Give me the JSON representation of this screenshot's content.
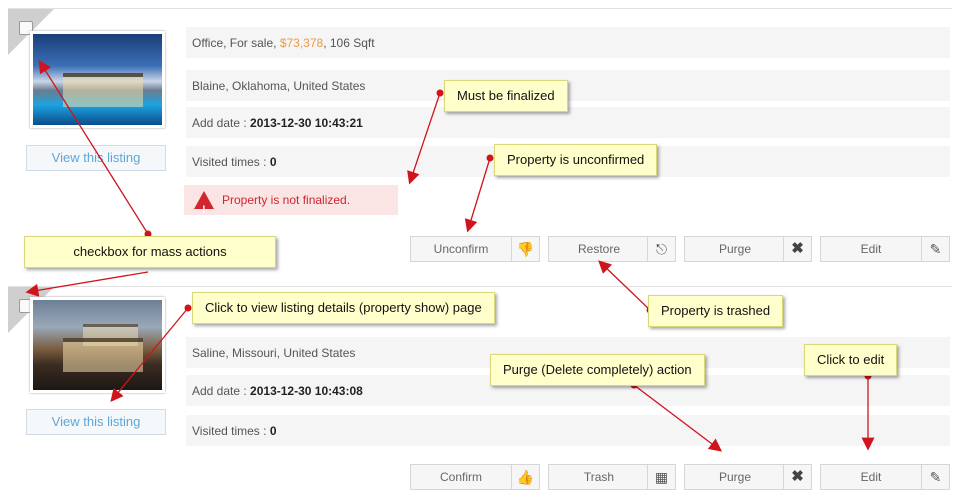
{
  "listings": [
    {
      "view_label": "View this listing",
      "summary": {
        "prefix": "Office, For sale, ",
        "price": "$73,378",
        "suffix": ", 106 Sqft"
      },
      "location": "Blaine, Oklahoma, United States",
      "add_date_label": "Add date : ",
      "add_date": "2013-12-30 10:43:21",
      "visited_label": "Visited times : ",
      "visited": "0",
      "alert": "Property is not finalized.",
      "actions": [
        "Unconfirm",
        "Restore",
        "Purge",
        "Edit"
      ]
    },
    {
      "view_label": "View this listing",
      "location": "Saline, Missouri, United States",
      "add_date_label": "Add date : ",
      "add_date": "2013-12-30 10:43:08",
      "visited_label": "Visited times : ",
      "visited": "0",
      "actions": [
        "Confirm",
        "Trash",
        "Purge",
        "Edit"
      ]
    }
  ],
  "callouts": {
    "must_finalize": "Must be finalized",
    "unconfirmed": "Property is unconfirmed",
    "mass_actions": "checkbox for mass actions",
    "view_details": "Click to view listing details (property show) page",
    "trashed": "Property is trashed",
    "purge": "Purge (Delete completely) action",
    "edit": "Click to edit"
  },
  "icons": {
    "unconfirm": "thumbs-down-icon",
    "restore": "restore-icon",
    "purge": "close-icon",
    "edit": "edit-icon",
    "confirm": "thumbs-up-icon",
    "trash": "trash-icon",
    "alert": "warning-icon"
  },
  "colors": {
    "price": "#e89a4a",
    "alert": "#d0262c",
    "link": "#5fa6d6",
    "callout": "#ffffcc",
    "arrow": "#d0141c"
  }
}
